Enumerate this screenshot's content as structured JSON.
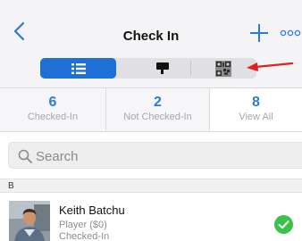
{
  "header": {
    "title": "Check In"
  },
  "segments": {
    "list_icon": "list-icon",
    "flag_icon": "flag-icon",
    "qr_icon": "qr-code-icon",
    "active": "list",
    "accent": "#1e6fd6"
  },
  "annotation": {
    "arrow_color": "#e02020"
  },
  "stats": [
    {
      "value": "6",
      "label": "Checked-In"
    },
    {
      "value": "2",
      "label": "Not Checked-In"
    },
    {
      "value": "8",
      "label": "View All"
    }
  ],
  "search": {
    "placeholder": "Search"
  },
  "list": {
    "section_letter": "B",
    "rows": [
      {
        "name": "Keith Batchu",
        "role": "Player ($0)",
        "status": "Checked-In",
        "status_color": "#3cc24a"
      }
    ]
  }
}
